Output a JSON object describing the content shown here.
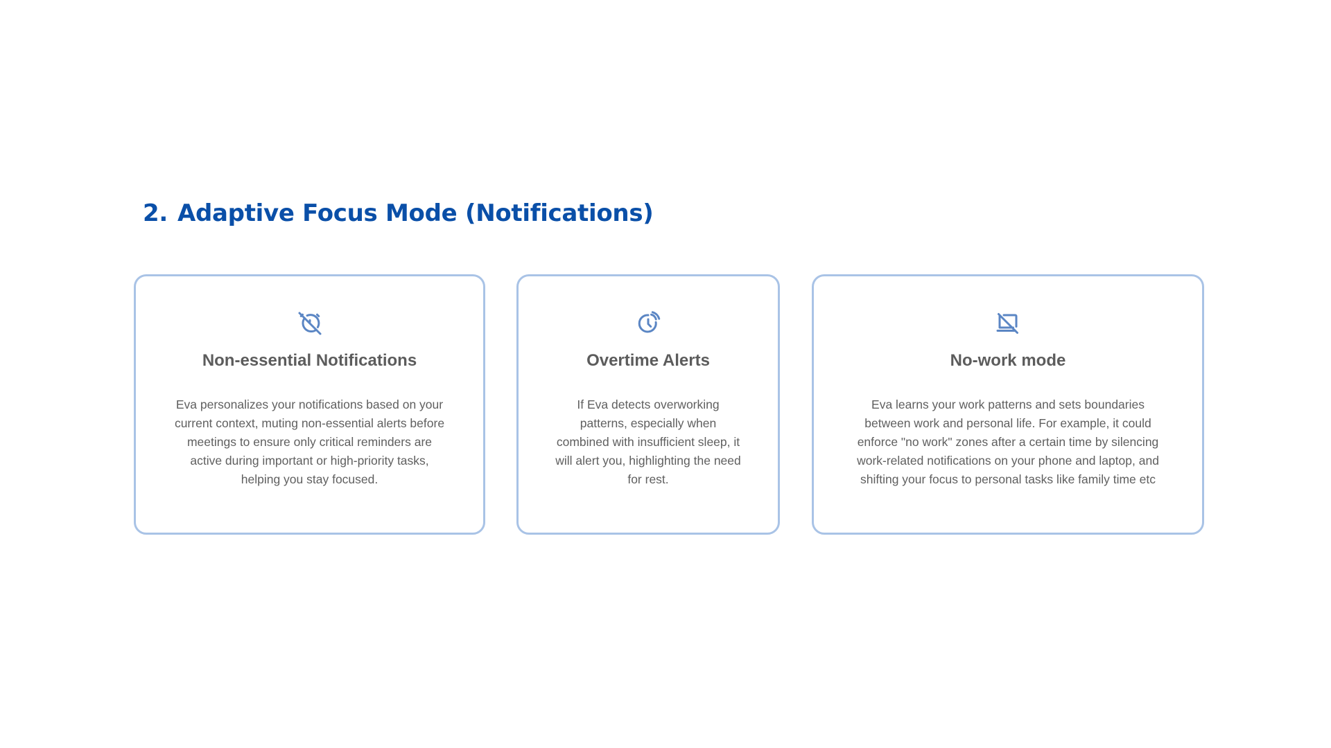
{
  "heading": {
    "number": "2.",
    "title": "Adaptive Focus Mode (Notifications)"
  },
  "colors": {
    "heading": "#0a4fa8",
    "icon": "#5b86c4",
    "card_border": "#a9c3e6",
    "title_text": "#5c5c5c",
    "body_text": "#5f5f5f"
  },
  "cards": [
    {
      "icon": "alarm-off-icon",
      "title": "Non-essential Notifications",
      "description": "Eva personalizes your notifications based on your current context, muting non-essential alerts before meetings to ensure only critical reminders are active during important or high-priority tasks, helping you stay focused."
    },
    {
      "icon": "clock-alert-icon",
      "title": "Overtime Alerts",
      "description": "If Eva detects overworking patterns, especially when combined with insufficient sleep, it will alert you, highlighting the need for rest."
    },
    {
      "icon": "laptop-off-icon",
      "title": "No-work mode",
      "description": "Eva learns your work patterns and sets boundaries between work and personal life. For example, it could enforce \"no work\" zones after a certain time by silencing work-related notifications on your phone and laptop, and shifting your focus to personal tasks like family time etc"
    }
  ]
}
